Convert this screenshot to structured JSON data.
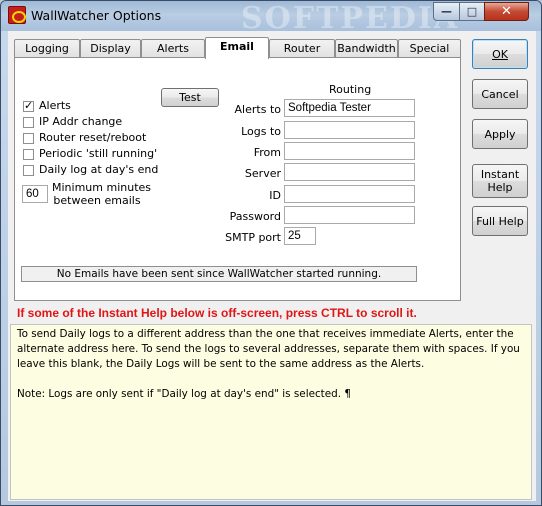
{
  "window": {
    "title": "WallWatcher Options",
    "watermark": "SOFTPEDIA",
    "minimize_glyph": "—",
    "maximize_glyph": "□",
    "close_glyph": "✕"
  },
  "tabs": [
    {
      "label": "Logging"
    },
    {
      "label": "Display"
    },
    {
      "label": "Alerts"
    },
    {
      "label": "Email"
    },
    {
      "label": "Router"
    },
    {
      "label": "Bandwidth"
    },
    {
      "label": "Special"
    }
  ],
  "active_tab": "Email",
  "email": {
    "test_button": "Test",
    "routing_heading": "Routing",
    "checkboxes": [
      {
        "label": "Alerts",
        "checked": true
      },
      {
        "label": "IP Addr change",
        "checked": false
      },
      {
        "label": "Router reset/reboot",
        "checked": false
      },
      {
        "label": "Periodic 'still running'",
        "checked": false
      },
      {
        "label": "Daily log at day's end",
        "checked": false
      }
    ],
    "min_minutes_value": "60",
    "min_minutes_label_1": "Minimum minutes",
    "min_minutes_label_2": "between emails",
    "fields": {
      "alerts_to": {
        "label": "Alerts to",
        "value": "Softpedia Tester"
      },
      "logs_to": {
        "label": "Logs to",
        "value": ""
      },
      "from": {
        "label": "From",
        "value": ""
      },
      "server": {
        "label": "Server",
        "value": ""
      },
      "id": {
        "label": "ID",
        "value": ""
      },
      "password": {
        "label": "Password",
        "value": ""
      },
      "smtp_port": {
        "label": "SMTP port",
        "value": "25"
      }
    },
    "status": "No Emails have been sent since WallWatcher started running."
  },
  "side_buttons": {
    "ok": "OK",
    "cancel": "Cancel",
    "apply": "Apply",
    "instant_help_1": "Instant",
    "instant_help_2": "Help",
    "full_help": "Full Help"
  },
  "help": {
    "warning": "If some of the Instant Help below is off-screen, press CTRL to scroll it.",
    "paragraph_1": "To send Daily logs to a different address than the one that receives immediate Alerts, enter the alternate address here. To send the logs to several addresses, separate them with spaces. If you leave this blank, the Daily Logs will be sent to the same address as the Alerts.",
    "paragraph_2": "Note: Logs are only sent if \"Daily log at day's end\" is selected. ¶"
  }
}
